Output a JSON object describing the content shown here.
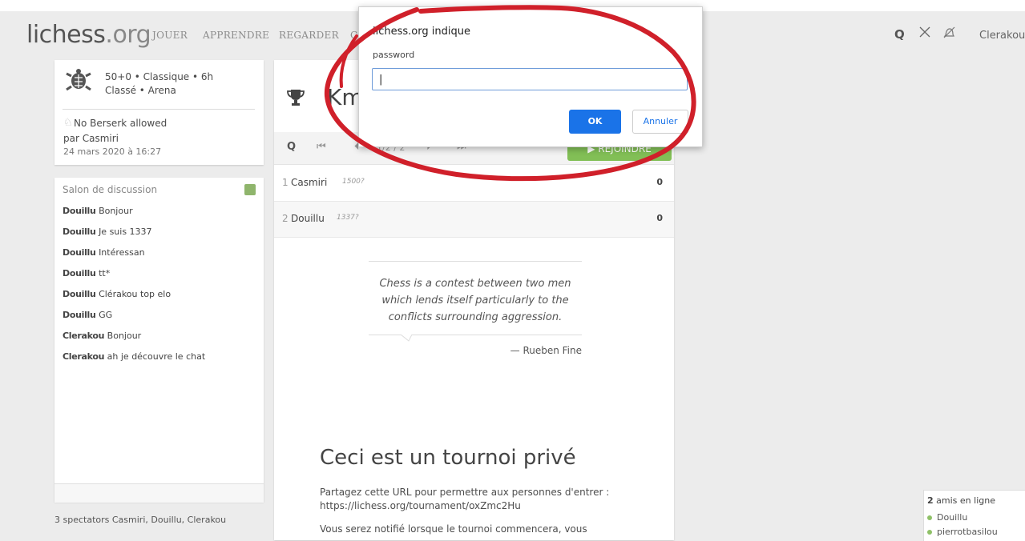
{
  "header": {
    "logo_main": "lichess",
    "logo_tld": ".org",
    "nav": [
      "JOUER",
      "APPRENDRE",
      "REGARDER",
      "C"
    ],
    "search_glyph": "Q",
    "swords_glyph": "⚔",
    "bell_glyph": "🔕",
    "username": "Clerakou"
  },
  "tournament_info": {
    "icon": "turtle-icon",
    "line1": "50+0 • Classique • 6h",
    "line2": "Classé • Arena",
    "berserk_note": "No Berserk allowed",
    "by": "par Casmiri",
    "date": "24 mars 2020 à 16:27"
  },
  "chat": {
    "title": "Salon de discussion",
    "messages": [
      {
        "user": "Douillu",
        "text": "Bonjour"
      },
      {
        "user": "Douillu",
        "text": "Je suis 1337"
      },
      {
        "user": "Douillu",
        "text": "Intéressan"
      },
      {
        "user": "Douillu",
        "text": "tt*"
      },
      {
        "user": "Douillu",
        "text": "Clérakou top elo"
      },
      {
        "user": "Douillu",
        "text": "GG"
      },
      {
        "user": "Clerakou",
        "text": "Bonjour"
      },
      {
        "user": "Clerakou",
        "text": "ah je découvre le chat"
      }
    ],
    "spectators": "3 spectators Casmiri, Douillu, Clerakou"
  },
  "main": {
    "title": "Km",
    "page_indicator": "1/2 / 2",
    "join_label": "▶ REJOINDRE",
    "standings": [
      {
        "rank": "1",
        "name": "Casmiri",
        "rating": "1500?",
        "score": "0"
      },
      {
        "rank": "2",
        "name": "Douillu",
        "rating": "1337?",
        "score": "0"
      }
    ],
    "quote": {
      "text": "Chess is a contest between two men which lends itself particularly to the conflicts surrounding aggression.",
      "author": "— Rueben Fine"
    },
    "private_title": "Ceci est un tournoi privé",
    "private_p1": "Partagez cette URL pour permettre aux personnes d'entrer : https://lichess.org/tournament/oxZmc2Hu",
    "private_p2": "Vous serez notifié lorsque le tournoi commencera, vous"
  },
  "dialog": {
    "title": "lichess.org indique",
    "message": "password",
    "input_value": "|",
    "ok_label": "OK",
    "cancel_label": "Annuler"
  },
  "friends": {
    "title_count": "2",
    "title_rest": "amis en ligne",
    "list": [
      "Douillu",
      "pierrotbasilou"
    ]
  },
  "colors": {
    "accent_green": "#82bf56",
    "dialog_blue": "#1a73e8",
    "annotation_red": "#d0202a"
  }
}
